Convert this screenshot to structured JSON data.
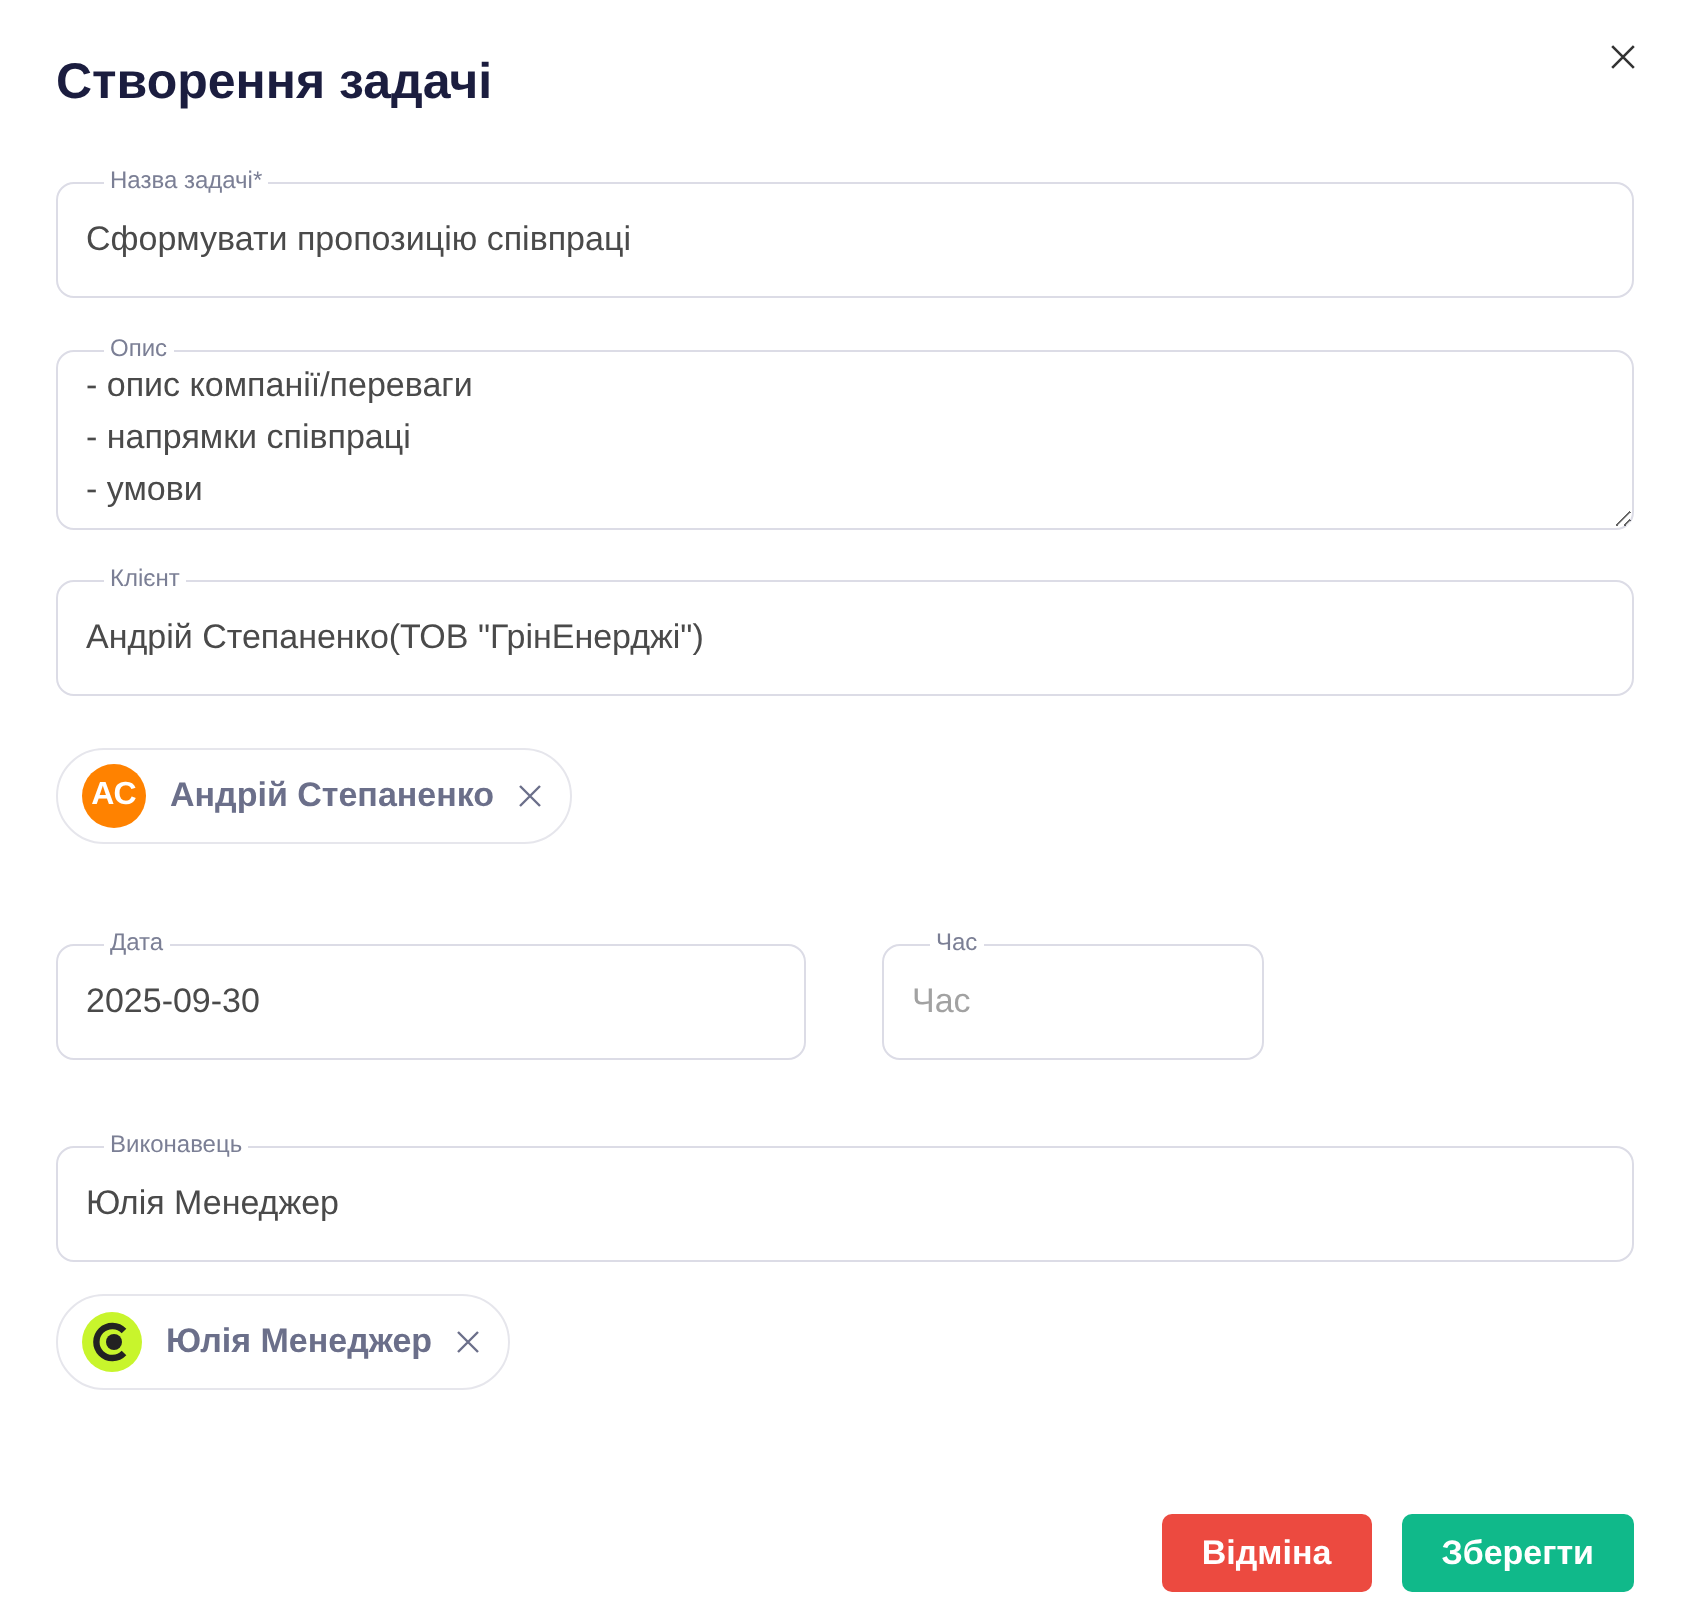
{
  "title": "Створення задачі",
  "task_name": {
    "label": "Назва задачі*",
    "value": "Сформувати пропозицію співпраці"
  },
  "description": {
    "label": "Опис",
    "value": "- опис компанії/переваги\n- напрямки співпраці\n- умови"
  },
  "client": {
    "label": "Клієнт",
    "value": "Андрій Степаненко(ТОВ \"ГрінЕнерджі\")"
  },
  "client_chips": [
    {
      "kind": "initials",
      "initials": "АС",
      "name": "Андрій Степаненко"
    }
  ],
  "date": {
    "label": "Дата",
    "value": "2025-09-30"
  },
  "time": {
    "label": "Час",
    "placeholder": "Час"
  },
  "executor": {
    "label": "Виконавець",
    "value": "Юлія Менеджер"
  },
  "executor_chips": [
    {
      "kind": "logo",
      "name": "Юлія Менеджер"
    }
  ],
  "buttons": [
    {
      "label": "Відміна",
      "kind": "cancel"
    },
    {
      "label": "Зберегти",
      "kind": "save"
    }
  ]
}
